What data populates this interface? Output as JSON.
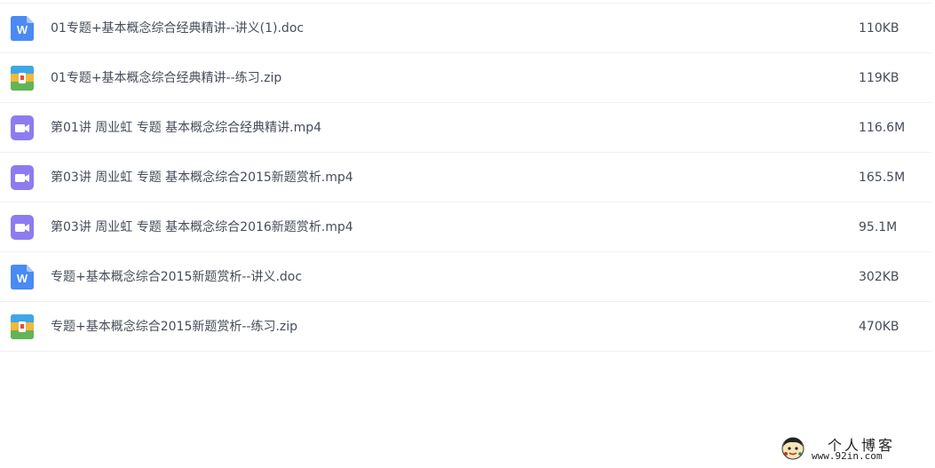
{
  "files": [
    {
      "name": "01专题+基本概念综合经典精讲--讲义(1).doc",
      "size": "110KB",
      "type": "doc",
      "icon": "word-doc-icon"
    },
    {
      "name": "01专题+基本概念综合经典精讲--练习.zip",
      "size": "119KB",
      "type": "zip",
      "icon": "zip-archive-icon"
    },
    {
      "name": "第01讲 周业虹 专题 基本概念综合经典精讲.mp4",
      "size": "116.6M",
      "type": "video",
      "icon": "video-file-icon"
    },
    {
      "name": "第03讲 周业虹 专题 基本概念综合2015新题赏析.mp4",
      "size": "165.5M",
      "type": "video",
      "icon": "video-file-icon"
    },
    {
      "name": "第03讲 周业虹 专题 基本概念综合2016新题赏析.mp4",
      "size": "95.1M",
      "type": "video",
      "icon": "video-file-icon"
    },
    {
      "name": "专题+基本概念综合2015新题赏析--讲义.doc",
      "size": "302KB",
      "type": "doc",
      "icon": "word-doc-icon"
    },
    {
      "name": "专题+基本概念综合2015新题赏析--练习.zip",
      "size": "470KB",
      "type": "zip",
      "icon": "zip-archive-icon"
    }
  ],
  "watermark": {
    "title": "个人博客",
    "url": "www.92in.com"
  },
  "colors": {
    "doc_icon": "#4a8af4",
    "video_icon": "#8c7cf0",
    "text": "#454d5a",
    "divider": "#eff1f4"
  }
}
